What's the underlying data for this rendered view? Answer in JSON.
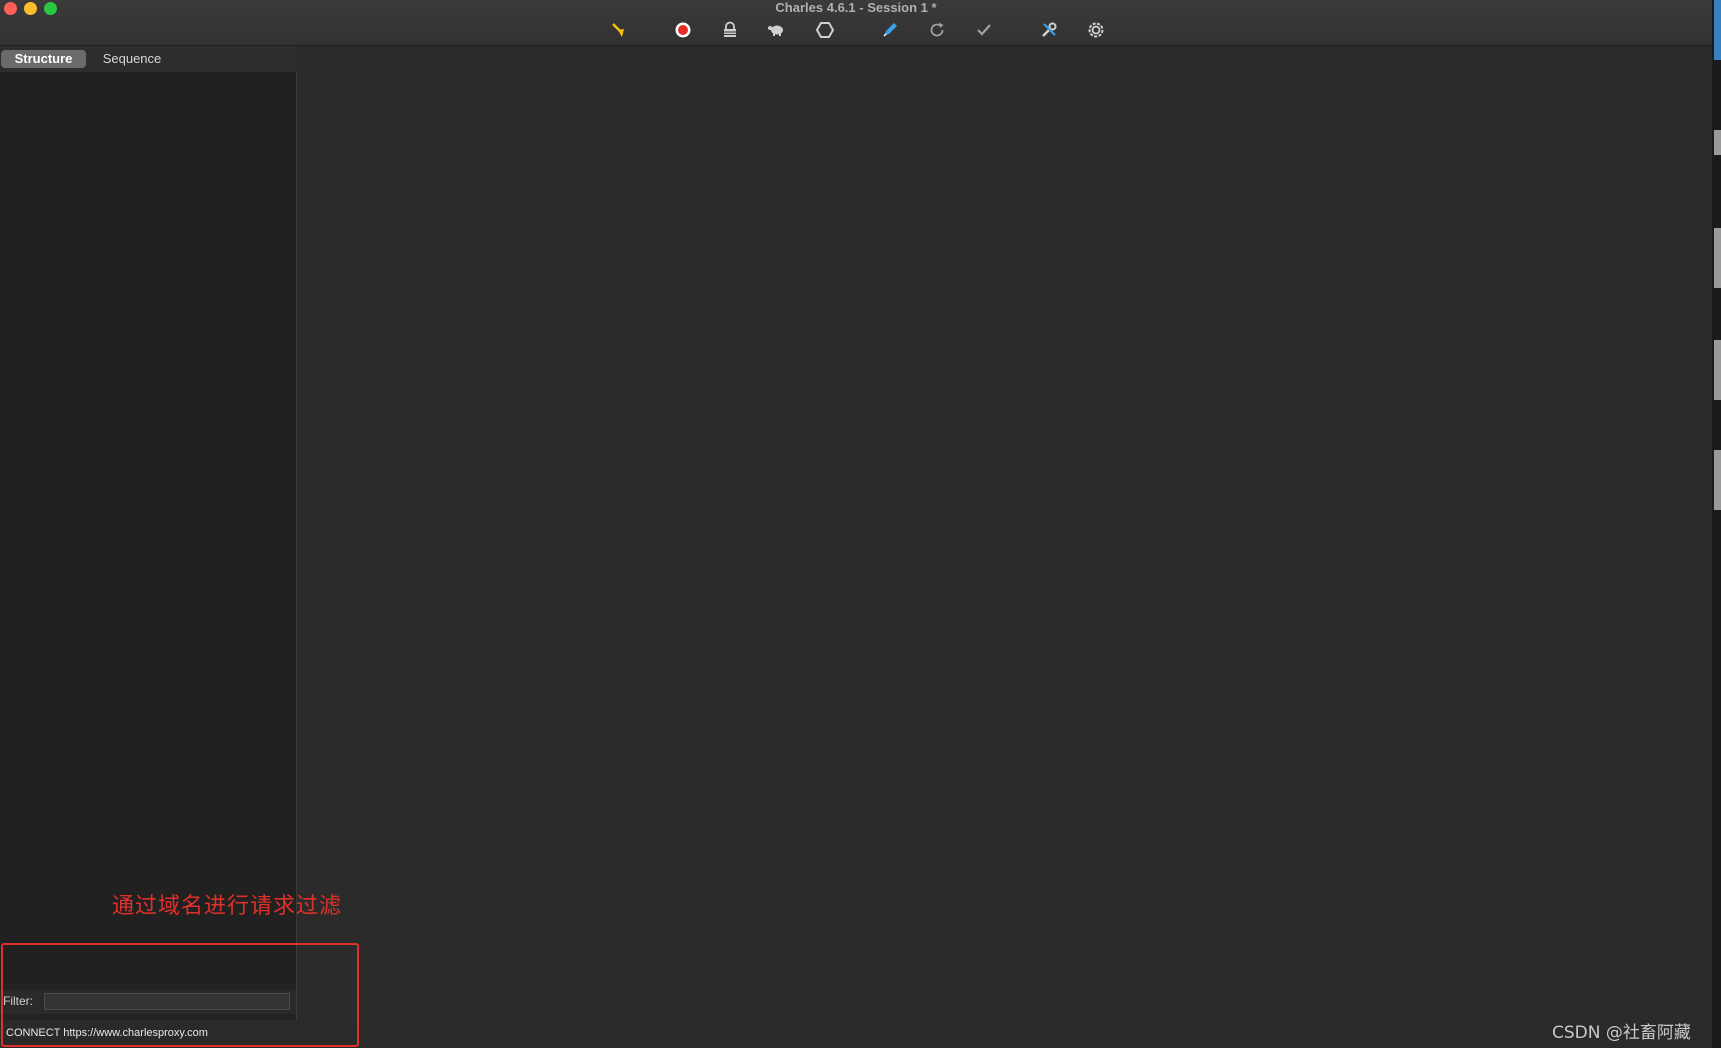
{
  "window": {
    "title": "Charles 4.6.1 - Session 1 *"
  },
  "toolbar": {
    "items": [
      {
        "name": "broom-icon",
        "color": "#f5c400"
      },
      {
        "name": "record-icon",
        "color": "#e0302a"
      },
      {
        "name": "lock-icon",
        "color": "#d0d0d0"
      },
      {
        "name": "turtle-icon",
        "color": "#d0d0d0"
      },
      {
        "name": "stop-hexagon-icon",
        "color": "#d0d0d0"
      },
      {
        "name": "pen-icon",
        "color": "#3aa0e8"
      },
      {
        "name": "refresh-icon",
        "color": "#a0a0a0"
      },
      {
        "name": "checkmark-icon",
        "color": "#a0a0a0"
      },
      {
        "name": "tools-icon",
        "color": "#d0d0d0"
      },
      {
        "name": "settings-gear-icon",
        "color": "#d0d0d0"
      }
    ]
  },
  "left_pane": {
    "tabs": [
      {
        "label": "Structure",
        "active": true
      },
      {
        "label": "Sequence",
        "active": false
      }
    ],
    "filter": {
      "label": "Filter:",
      "value": ""
    }
  },
  "status_bar": {
    "text": "CONNECT https://www.charlesproxy.com"
  },
  "annotation": {
    "text": "通过域名进行请求过滤",
    "color": "#e0302a"
  },
  "watermark": {
    "text": "CSDN @社畜阿藏"
  }
}
